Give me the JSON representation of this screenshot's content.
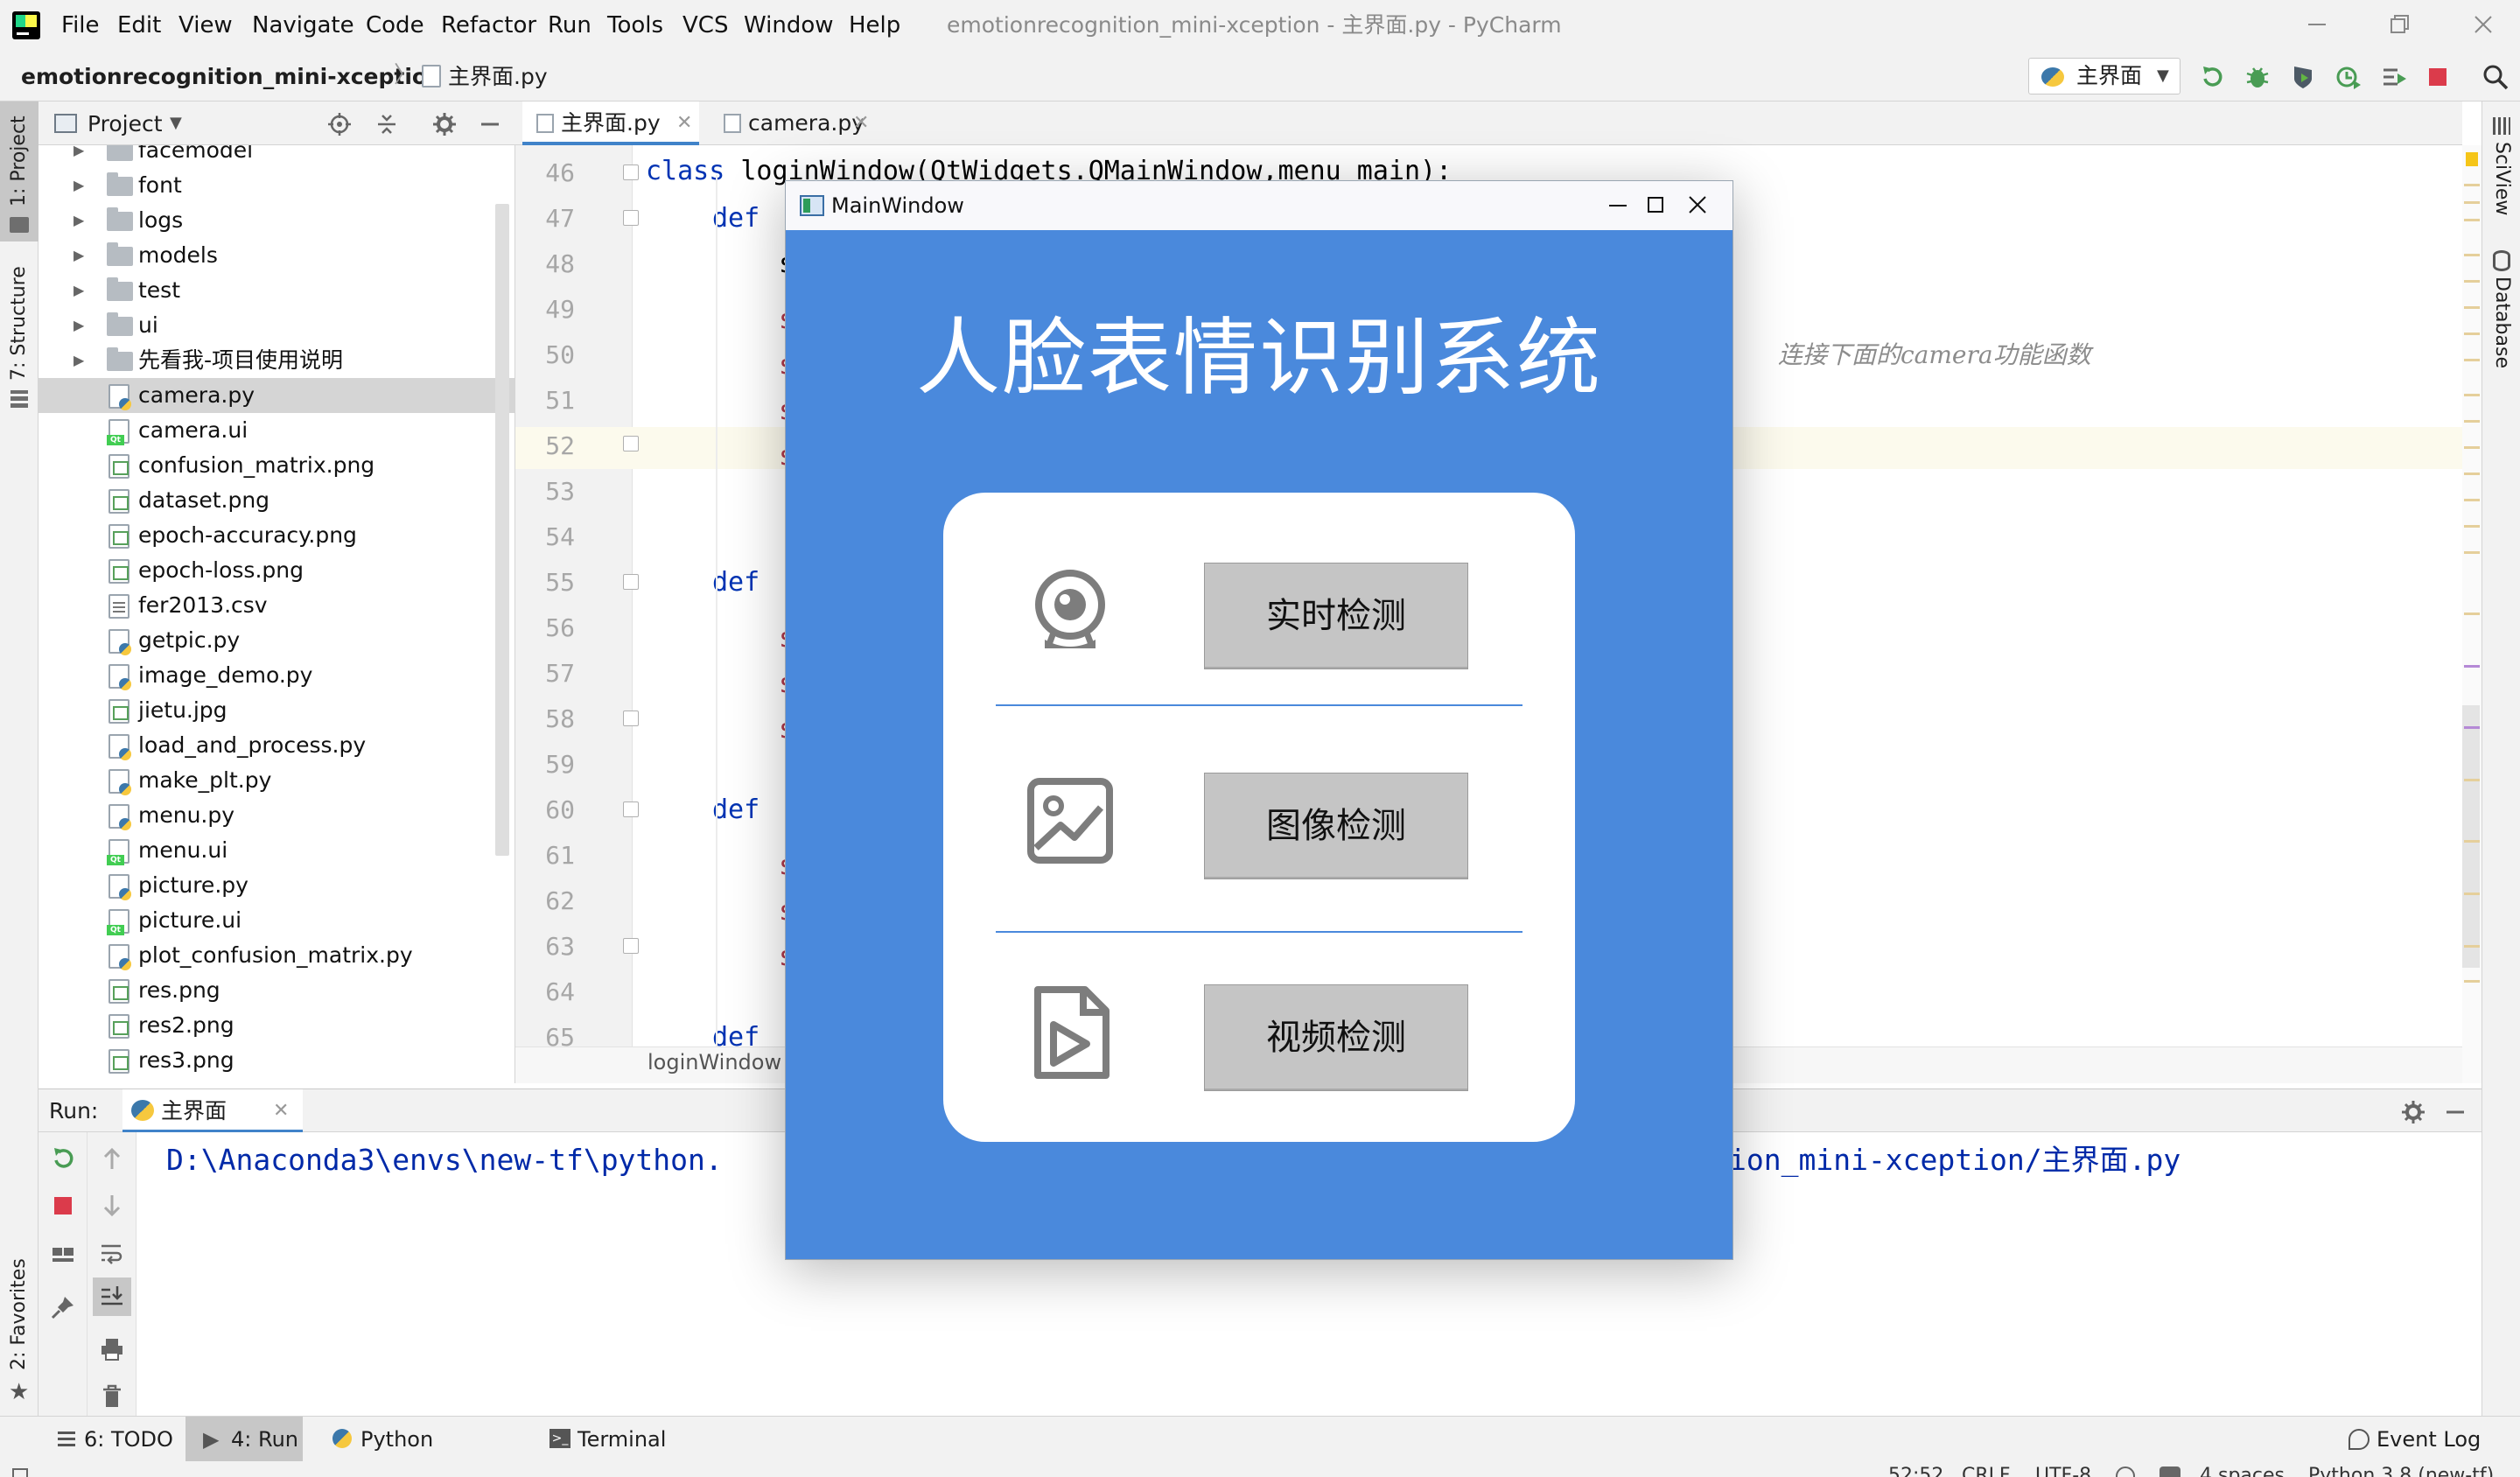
{
  "menu_bar": {
    "items": [
      "File",
      "Edit",
      "View",
      "Navigate",
      "Code",
      "Refactor",
      "Run",
      "Tools",
      "VCS",
      "Window",
      "Help"
    ],
    "window_title": "emotionrecognition_mini-xception - 主界面.py - PyCharm"
  },
  "navbar": {
    "project": "emotionrecognition_mini-xception",
    "file": "主界面.py",
    "run_config": "主界面"
  },
  "left_strip": {
    "project_tab": "1: Project",
    "structure_tab": "7: Structure",
    "favorites_tab": "2: Favorites"
  },
  "right_strip": {
    "sciview_tab": "SciView",
    "database_tab": "Database"
  },
  "project_panel": {
    "title": "Project",
    "items": [
      {
        "label": "facemodel",
        "kind": "folder"
      },
      {
        "label": "font",
        "kind": "folder"
      },
      {
        "label": "logs",
        "kind": "folder"
      },
      {
        "label": "models",
        "kind": "folder"
      },
      {
        "label": "test",
        "kind": "folder"
      },
      {
        "label": "ui",
        "kind": "folder"
      },
      {
        "label": "先看我-项目使用说明",
        "kind": "folder"
      },
      {
        "label": "camera.py",
        "kind": "py"
      },
      {
        "label": "camera.ui",
        "kind": "ui"
      },
      {
        "label": "confusion_matrix.png",
        "kind": "img"
      },
      {
        "label": "dataset.png",
        "kind": "img"
      },
      {
        "label": "epoch-accuracy.png",
        "kind": "img"
      },
      {
        "label": "epoch-loss.png",
        "kind": "img"
      },
      {
        "label": "fer2013.csv",
        "kind": "csv"
      },
      {
        "label": "getpic.py",
        "kind": "py"
      },
      {
        "label": "image_demo.py",
        "kind": "py"
      },
      {
        "label": "jietu.jpg",
        "kind": "img"
      },
      {
        "label": "load_and_process.py",
        "kind": "py"
      },
      {
        "label": "make_plt.py",
        "kind": "py"
      },
      {
        "label": "menu.py",
        "kind": "py"
      },
      {
        "label": "menu.ui",
        "kind": "ui"
      },
      {
        "label": "picture.py",
        "kind": "py"
      },
      {
        "label": "picture.ui",
        "kind": "ui"
      },
      {
        "label": "plot_confusion_matrix.py",
        "kind": "py"
      },
      {
        "label": "res.png",
        "kind": "img"
      },
      {
        "label": "res2.png",
        "kind": "img"
      },
      {
        "label": "res3.png",
        "kind": "img"
      }
    ],
    "selected": "camera.py"
  },
  "editor": {
    "tabs": [
      {
        "label": "主界面.py",
        "active": true
      },
      {
        "label": "camera.py",
        "active": false
      }
    ],
    "line_numbers": [
      "46",
      "47",
      "48",
      "49",
      "50",
      "51",
      "52",
      "53",
      "54",
      "55",
      "56",
      "57",
      "58",
      "59",
      "60",
      "61",
      "62",
      "63",
      "64",
      "65"
    ],
    "class_line": "loginWindow(QtWidgets.QMainWindow,menu_main):",
    "class_kw": "class",
    "def_kw": "def",
    "s_char": "s",
    "comment": "连接下面的camera功能函数",
    "bottom_breadcrumb": "loginWindow"
  },
  "run_panel": {
    "label": "Run:",
    "tab": "主界面",
    "command_head": "D:\\Anaconda3\\envs\\new-tf\\python.",
    "command_tail": "ion_mini-xception/主界面.py"
  },
  "tool_tabs": [
    "6: TODO",
    "4: Run",
    "Python Console",
    "Terminal"
  ],
  "event_log": "Event Log",
  "status": {
    "position": "52:52",
    "line_sep": "CRLF",
    "encoding": "UTF-8",
    "indent": "4 spaces",
    "interpreter": "Python 3.8 (new-tf)"
  },
  "qt_window": {
    "title": "MainWindow",
    "heading": "人脸表情识别系统",
    "buttons": [
      {
        "label": "实时检测",
        "icon": "webcam-icon"
      },
      {
        "label": "图像检测",
        "icon": "image-icon"
      },
      {
        "label": "视频检测",
        "icon": "video-file-icon"
      }
    ]
  },
  "colors": {
    "qt_background": "#4a89dc",
    "qt_button": "#c5c5c5",
    "keyword": "#0033b3",
    "console_text": "#0029a8"
  }
}
